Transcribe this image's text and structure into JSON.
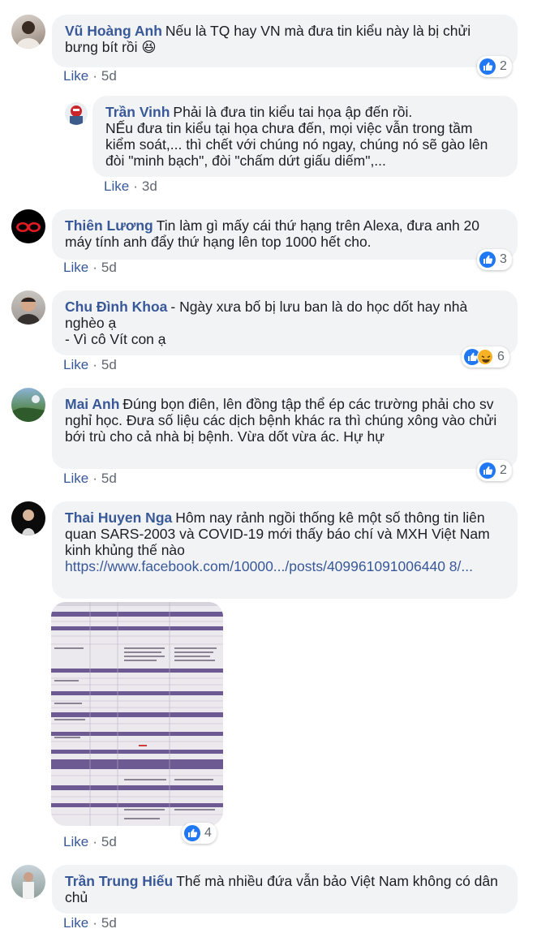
{
  "comments": [
    {
      "author": "Vũ Hoàng Anh",
      "text": "Nếu là TQ hay VN mà đưa tin kiểu này là bị chửi bưng bít rồi 😆",
      "like": "Like",
      "time": "5d",
      "reactions": "2"
    },
    {
      "author": "Trần Vinh",
      "text": "Phải là đưa tin kiểu tai họa ập đến rồi.\nNẾu đưa tin kiểu tại họa chưa đến, mọi việc vẫn trong tầm kiểm soát,... thì chết với chúng nó ngay, chúng nó sẽ gào lên đòi \"minh bạch\", đòi \"chấm dứt giấu diếm\",...",
      "like": "Like",
      "time": "3d"
    },
    {
      "author": "Thiên Lương",
      "text": "Tin làm gì mấy cái thứ hạng trên Alexa, đưa anh 20 máy tính anh đẩy thứ hạng lên top 1000 hết cho.",
      "like": "Like",
      "time": "5d",
      "reactions": "3"
    },
    {
      "author": "Chu Đình Khoa",
      "text": "- Ngày xưa bố bị lưu ban là do học dốt hay nhà nghèo ạ\n- Vì cô Vít con ạ",
      "like": "Like",
      "time": "5d",
      "reactions": "6"
    },
    {
      "author": "Mai Anh",
      "text": "Đúng bọn điên, lên đồng tập thể ép các trường phải cho sv nghỉ học. Đưa số liệu các dịch bệnh khác ra thì chúng xông vào chửi bới trù cho cả nhà bị bệnh. Vừa dốt vừa ác. Hự hự",
      "like": "Like",
      "time": "5d",
      "reactions": "2"
    },
    {
      "author": "Thai Huyen Nga",
      "text": "Hôm nay rảnh ngồi thống kê một số thông tin liên quan SARS-2003 và COVID-19 mới thấy báo chí và MXH Việt Nam kinh khủng thế nào",
      "link": "https://www.facebook.com/10000.../posts/409961091006440 8/...",
      "like": "Like",
      "time": "5d",
      "reactions": "4"
    },
    {
      "author": "Trần Trung Hiếu",
      "text": "Thế mà nhiều đứa vẫn bảo Việt Nam không có dân chủ",
      "like": "Like",
      "time": "5d"
    }
  ],
  "colors": {
    "author": "#385898",
    "bubble": "#f2f3f5",
    "meta": "#606770",
    "like_reaction": "#2078f4",
    "haha_reaction": "#f7b125"
  },
  "icons": {
    "like_reaction": "thumbs-up-icon",
    "haha_reaction": "laughing-face-icon"
  }
}
